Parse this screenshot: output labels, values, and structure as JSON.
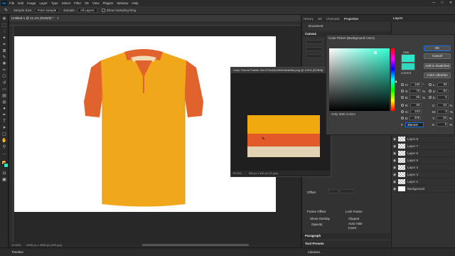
{
  "menubar": {
    "items": [
      "File",
      "Edit",
      "Image",
      "Layer",
      "Type",
      "Select",
      "Filter",
      "3D",
      "View",
      "Plugins",
      "Window",
      "Help"
    ],
    "window_controls": [
      "—",
      "□",
      "✕"
    ]
  },
  "options": {
    "sample_size_label": "Sample Size:",
    "sample_size_value": "Point Sample",
    "sample_label": "Sample:",
    "sample_value": "All Layers",
    "show_ring_label": "Show Sampling Ring"
  },
  "document": {
    "tab_label": "Untitled-1 @ 11.1% (RGB/8) *",
    "zoom": "11.66%",
    "size": "6000 px x 3996 px (300 ppi)"
  },
  "panels": {
    "tabs": [
      "History",
      "3D",
      "Channels",
      "Properties"
    ],
    "document_label": "Document",
    "canvas_section": "Canvas",
    "offset_label": "Offset",
    "frame_label": "Frame Offset",
    "lock_frame": "Lock Frame",
    "show_overlay": "Show Overlay",
    "opacity_label": "Opacity:",
    "clipped": "Clipped",
    "auto_hide": "Auto Hide",
    "invert": "Invert",
    "paragraph": "Paragraph",
    "tool_presets": "Tool Presets"
  },
  "layers": {
    "tab_label": "Layers",
    "group_label": "Group 1",
    "rows": [
      "Layer 8",
      "Layer 7",
      "Layer 6",
      "Layer 5",
      "Layer 4",
      "Layer 3",
      "Layer 2",
      "Layer 1",
      "Background"
    ]
  },
  "color_picker": {
    "title": "Color Picker (Background Color)",
    "new_label": "new",
    "current_label": "current",
    "ok": "OK",
    "cancel": "Cancel",
    "add_swatches": "Add to Swatches",
    "color_libraries": "Color Libraries",
    "only_web": "Only Web Colors",
    "hex_prefix": "#",
    "hex_value": "30e4c9",
    "left_values": [
      {
        "label": "H:",
        "value": "168",
        "unit": "°"
      },
      {
        "label": "S:",
        "value": "76",
        "unit": "%"
      },
      {
        "label": "B:",
        "value": "95",
        "unit": "%"
      },
      {
        "label": "R:",
        "value": "59",
        "unit": ""
      },
      {
        "label": "G:",
        "value": "243",
        "unit": ""
      },
      {
        "label": "B:",
        "value": "205",
        "unit": ""
      }
    ],
    "right_values": [
      {
        "label": "L:",
        "value": "86",
        "unit": ""
      },
      {
        "label": "a:",
        "value": "-52",
        "unit": ""
      },
      {
        "label": "b:",
        "value": "5",
        "unit": ""
      },
      {
        "label": "C:",
        "value": "54",
        "unit": "%"
      },
      {
        "label": "M:",
        "value": "0",
        "unit": "%"
      },
      {
        "label": "Y:",
        "value": "35",
        "unit": "%"
      },
      {
        "label": "K:",
        "value": "0",
        "unit": "%"
      }
    ]
  },
  "theme_window": {
    "title": "Color Theme Palette 2tni.fi70a1f4m9f4ebfea6f0a.png @ 100% (RGB/8)",
    "zoom": "75.23%",
    "size": "900 px x 490 px (72 ppi)",
    "bands": [
      "#f0a90e",
      "#e35a2a",
      "#e1d2b4"
    ]
  },
  "timeline": {
    "label": "Timeline"
  },
  "libraries": {
    "label": "Libraries"
  },
  "colors": {
    "shirt_body": "#f0a71a",
    "shirt_sleeve": "#e0622c",
    "collar_inner": "#f2dcb8"
  }
}
